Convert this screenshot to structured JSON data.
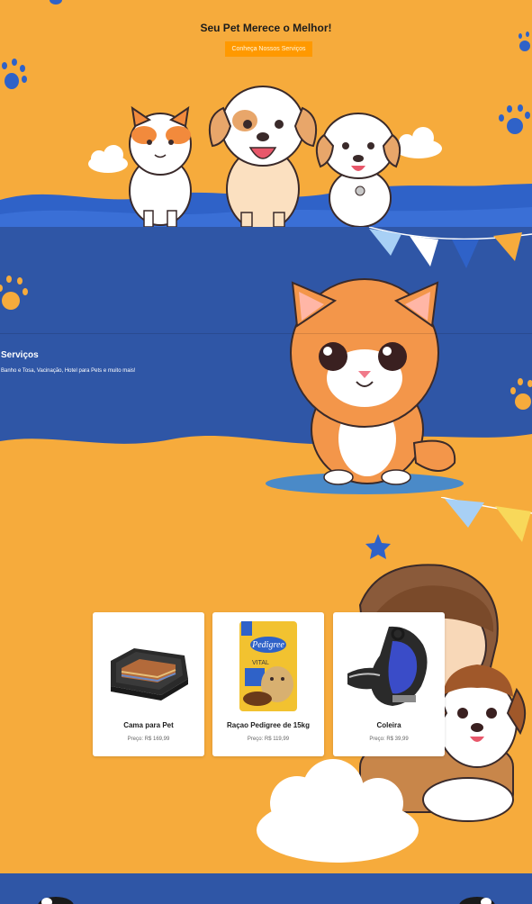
{
  "hero": {
    "title": "Seu Pet Merece o Melhor!",
    "cta_label": "Conheça Nossos Serviços"
  },
  "services": {
    "title": "Serviços",
    "description": "Banho e Tosa, Vacinação, Hotel para Pets e muito mais!"
  },
  "products": {
    "items": [
      {
        "name": "Cama para Pet",
        "price": "Preço: R$ 169,99",
        "image": "pet-bed"
      },
      {
        "name": "Raçao Pedigree de 15kg",
        "price": "Preço: R$ 119,99",
        "image": "dog-food-bag",
        "brand": "Pedigree",
        "sub": "VITAL"
      },
      {
        "name": "Coleira",
        "price": "Preço: R$ 39,99",
        "image": "dog-harness"
      }
    ]
  },
  "colors": {
    "orange_bg": "#f6ab3c",
    "blue_bg": "#2f56a6",
    "button": "#ff9900",
    "card": "#ffffff"
  }
}
